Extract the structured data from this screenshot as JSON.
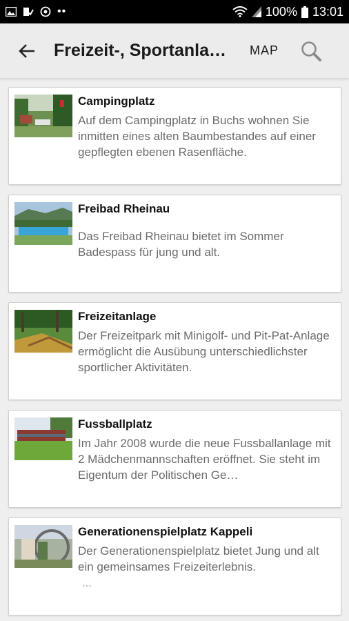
{
  "status_bar": {
    "battery": "100%",
    "time": "13:01",
    "icons": [
      "gallery-icon",
      "check-icon",
      "target-icon",
      "more-dots-icon",
      "wifi-icon",
      "signal-icon",
      "battery-icon"
    ]
  },
  "app_bar": {
    "title": "Freizeit-, Sportanla…",
    "map_label": "MAP",
    "back_icon": "back-arrow-icon",
    "search_icon": "search-icon"
  },
  "items": [
    {
      "title": "Campingplatz",
      "description": "Auf dem Campingplatz in Buchs wohnen Sie inmitten eines alten Baumbestandes auf einer gepflegten ebenen Rasenfläche."
    },
    {
      "title": "Freibad Rheinau",
      "description": "Das Freibad Rheinau bietet im Sommer Badespass für jung und alt."
    },
    {
      "title": "Freizeitanlage",
      "description": "Der Freizeitpark mit Minigolf- und Pit-Pat-Anlage ermöglicht die Ausübung unterschiedlichster sportlicher Aktivitäten."
    },
    {
      "title": "Fussballplatz",
      "description": "Im Jahr 2008 wurde die neue Fussballanlage mit 2 Mädchenmannschaften eröffnet. Sie steht im Eigentum der Politischen Ge…"
    },
    {
      "title": "Generationenspielplatz Kappeli",
      "description": "Der Generationenspielplatz bietet Jung und alt ein gemeinsames Freizeiterlebnis.",
      "more": "…"
    }
  ]
}
